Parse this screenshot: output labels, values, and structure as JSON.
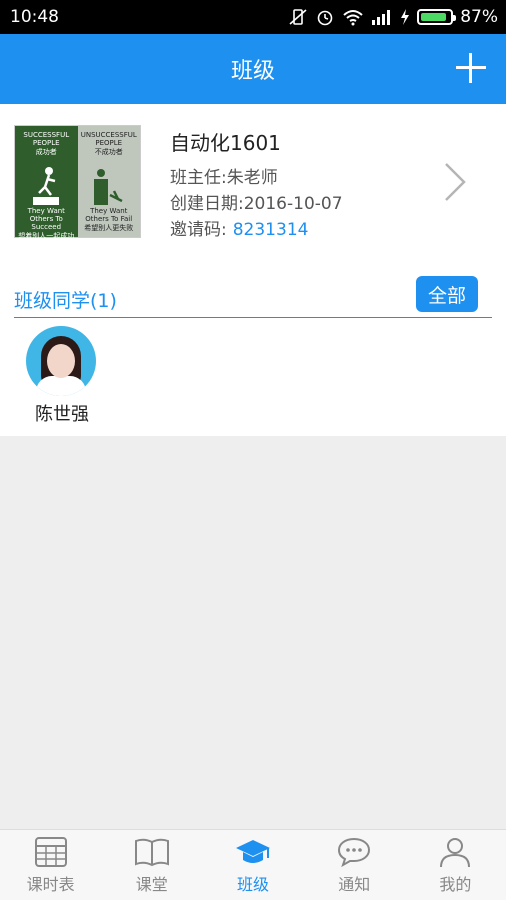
{
  "status_bar": {
    "time": "10:48",
    "battery_percent": "87%",
    "battery_level": 0.87,
    "icons": [
      "vibrate-off-icon",
      "alarm-icon",
      "wifi-icon",
      "signal-icon",
      "charging-icon",
      "battery-icon"
    ]
  },
  "app_bar": {
    "title": "班级",
    "add_icon": "plus-icon"
  },
  "class_card": {
    "cover_left_line1": "SUCCESSFUL",
    "cover_left_line2": "PEOPLE",
    "cover_left_zh": "成功者",
    "cover_left_caption": "They Want Others To Succeed",
    "cover_left_caption_zh": "想着别人一起成功",
    "cover_right_line1": "UNSUCCESSFUL",
    "cover_right_line2": "PEOPLE",
    "cover_right_zh": "不成功者",
    "cover_right_caption": "They Want Others To Fail",
    "cover_right_caption_zh": "希望别人更失败",
    "name": "自动化1601",
    "teacher": "班主任:朱老师",
    "created": "创建日期:2016-10-07",
    "invite_label": "邀请码:",
    "invite_code": "8231314",
    "chevron_icon": "chevron-right-icon"
  },
  "members_section": {
    "title": "班级同学(1)",
    "all_button": "全部",
    "members": [
      {
        "name": "陈世强"
      }
    ]
  },
  "tab_bar": {
    "tabs": [
      {
        "label": "课时表",
        "icon": "timetable-icon",
        "active": false
      },
      {
        "label": "课堂",
        "icon": "book-icon",
        "active": false
      },
      {
        "label": "班级",
        "icon": "graduation-cap-icon",
        "active": true
      },
      {
        "label": "通知",
        "icon": "chat-bubble-icon",
        "active": false
      },
      {
        "label": "我的",
        "icon": "person-icon",
        "active": false
      }
    ]
  },
  "colors": {
    "accent": "#1e90f0",
    "tab_inactive": "#888888"
  }
}
